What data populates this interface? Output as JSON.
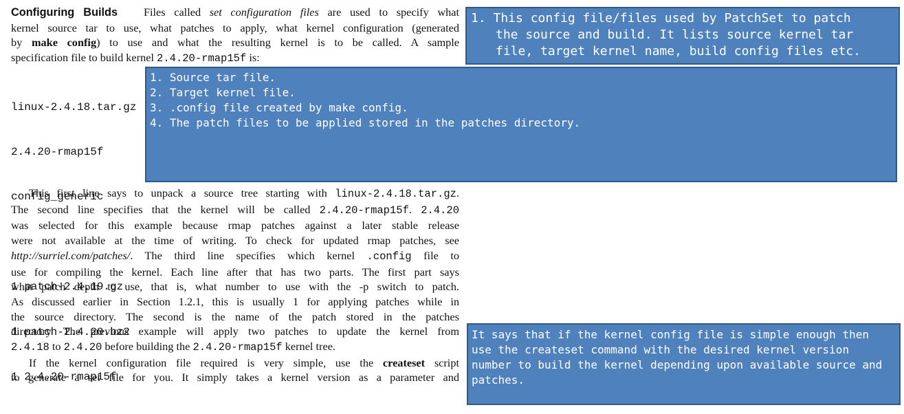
{
  "intro": {
    "heading": "Configuring Builds",
    "l1_a": "Files called ",
    "l1_em": "set configuration files",
    "l1_b": " are used to specify what",
    "l2": "kernel source tar to use, what patches to apply, what kernel configuration (generated",
    "l3_a": "by ",
    "l3_bold": "make config",
    "l3_b": ") to use and what the resulting kernel is to be called.  A sample",
    "l4_a": "specification file to build kernel ",
    "l4_code": "2.4.20-rmap15f",
    "l4_b": " is:"
  },
  "config_file": {
    "lines": [
      "linux-2.4.18.tar.gz",
      "2.4.20-rmap15f",
      "config_generic",
      "",
      "1 patch-2.4.19.gz",
      "1 patch-2.4.20.bz2",
      "1 2.4.20-rmap15f"
    ]
  },
  "body": {
    "p1_l1_a": "This first line says to unpack a source tree starting with ",
    "p1_l1_code": "linux-2.4.18.tar.gz",
    "p1_l1_b": ".",
    "p1_l2_a": "The second line specifies that the kernel will be called ",
    "p1_l2_code1": "2.4.20-rmap15f",
    "p1_l2_b": ".  ",
    "p1_l2_code2": "2.4.20",
    "p1_l3": "was selected for this example because rmap patches against a later stable release",
    "p1_l4": "were not available at the time of writing.  To check for updated rmap patches, see",
    "p1_l5_em": "http://surriel.com/patches/",
    "p1_l5_a": ".  The third line specifies which kernel ",
    "p1_l5_code": ".config",
    "p1_l5_b": " file to",
    "p1_l6": "use for compiling the kernel. Each line after that has two parts. The first part says",
    "p1_l7": "what patch depth to use, that is, what number to use with the -p switch to patch.",
    "p1_l8": "As discussed earlier in Section 1.2.1, this is usually 1 for applying patches while in",
    "p1_l9": "the source directory.  The second is the name of the patch stored in the patches",
    "p1_l10": "directory. The previous example will apply two patches to update the kernel from",
    "p1_l11_code1": "2.4.18",
    "p1_l11_a": " to ",
    "p1_l11_code2": "2.4.20",
    "p1_l11_b": " before building the ",
    "p1_l11_code3": "2.4.20-rmap15f",
    "p1_l11_c": " kernel tree.",
    "p2_l1_a": "If the kernel configuration file required is very simple, use the ",
    "p2_l1_bold": "createset",
    "p2_l1_b": " script",
    "p2_l2": "to generate a set file for you.  It simply takes a kernel version as a parameter and"
  },
  "annotations": {
    "note1": [
      "1. This config file/files used by PatchSet to patch",
      "the source and build. It lists source kernel tar",
      "file, target kernel name, build config files etc."
    ],
    "note2": [
      "1. Source tar file.",
      "2. Target kernel file.",
      "3. .config file created by make config.",
      "4. The patch files to be applied stored in the patches directory."
    ],
    "note3": [
      "It says that if the kernel config file is simple enough then",
      "use the createset command with the desired kernel version",
      "number to build the kernel depending upon available source and",
      "patches."
    ],
    "colors": {
      "fill": "#4f81bd",
      "border": "#2f5a88",
      "text": "#ffffff"
    }
  }
}
